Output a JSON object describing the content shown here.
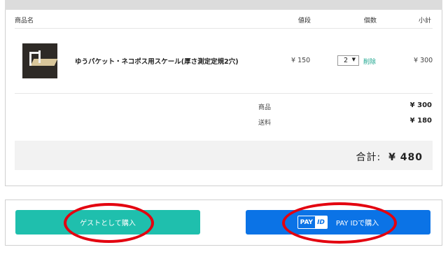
{
  "cart": {
    "columns": {
      "name": "商品名",
      "price": "値段",
      "quantity": "個数",
      "subtotal": "小計"
    },
    "item": {
      "name": "ゆうパケット・ネコポス用スケール(厚さ測定定規2穴)",
      "price": "¥ 150",
      "quantity": "2",
      "delete_label": "削除",
      "subtotal": "¥ 300"
    },
    "summary": {
      "goods_label": "商品",
      "goods_value": "¥ 300",
      "shipping_label": "送料",
      "shipping_value": "¥ 180"
    },
    "total": {
      "label": "合計:",
      "value": "¥ 480"
    }
  },
  "buttons": {
    "guest_label": "ゲストとして購入",
    "payid_logo_pay": "PAY",
    "payid_logo_id": "ID",
    "payid_label": "PAY IDで購入"
  },
  "colors": {
    "guest_button": "#1fbfad",
    "payid_button": "#0b73e6",
    "highlight_circle": "#e3000f",
    "delete_link": "#18a48c"
  },
  "icons": {
    "quantity_dropdown": "chevron-down-icon",
    "product_image": "product-thumbnail"
  }
}
